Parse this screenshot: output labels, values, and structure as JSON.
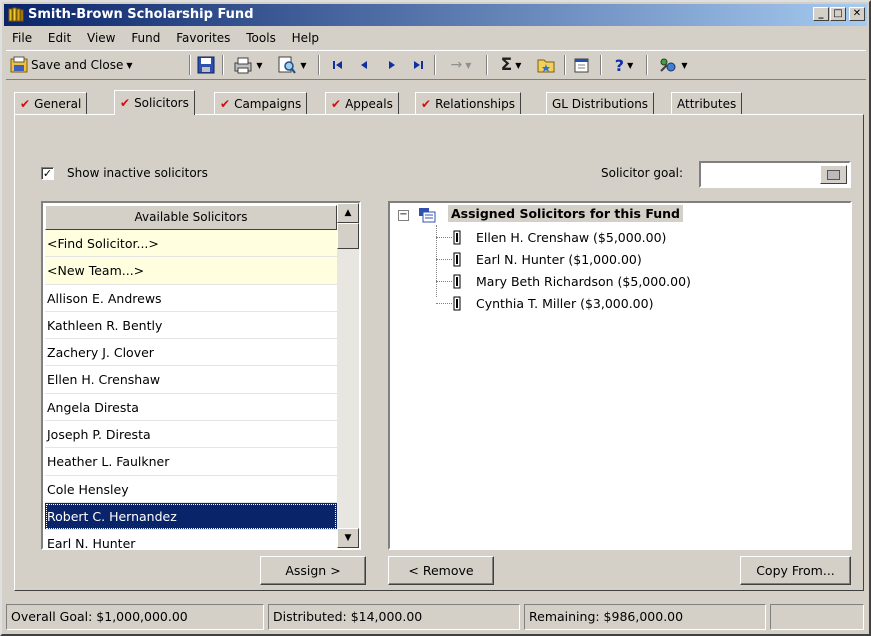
{
  "window": {
    "title": "Smith-Brown Scholarship Fund"
  },
  "menu": [
    "File",
    "Edit",
    "View",
    "Fund",
    "Favorites",
    "Tools",
    "Help"
  ],
  "toolbar": {
    "save_close_label": "Save and Close",
    "icons": [
      "save-close-icon",
      "save-icon",
      "print-icon",
      "preview-icon",
      "first-record-icon",
      "previous-record-icon",
      "next-record-icon",
      "last-record-icon",
      "go-to-icon",
      "sum-icon",
      "folder-icon",
      "properties-icon",
      "help-icon",
      "tools-icon"
    ]
  },
  "tabs": [
    {
      "label": "General",
      "checked": true
    },
    {
      "label": "Solicitors",
      "checked": true,
      "active": true
    },
    {
      "label": "Campaigns",
      "checked": true
    },
    {
      "label": "Appeals",
      "checked": true
    },
    {
      "label": "Relationships",
      "checked": true
    },
    {
      "label": "GL Distributions",
      "checked": false
    },
    {
      "label": "Attributes",
      "checked": false
    }
  ],
  "solicitors": {
    "show_inactive_label": "Show inactive solicitors",
    "show_inactive_checked": true,
    "goal_label": "Solicitor goal:",
    "goal_value": "",
    "available_header": "Available Solicitors",
    "available": [
      "<Find Solicitor...>",
      "<New Team...>",
      "Allison E. Andrews",
      "Kathleen R. Bently",
      "Zachery J. Clover",
      "Ellen H. Crenshaw",
      "Angela Diresta",
      "Joseph P. Diresta",
      "Heather L. Faulkner",
      "Cole Hensley",
      "Robert C. Hernandez",
      "Earl N. Hunter"
    ],
    "selected_index": 10,
    "assigned_root": "Assigned Solicitors for this Fund",
    "assigned": [
      "Ellen H. Crenshaw ($5,000.00)",
      "Earl N. Hunter ($1,000.00)",
      "Mary Beth Richardson ($5,000.00)",
      "Cynthia T. Miller ($3,000.00)"
    ],
    "assign_label": "Assign >",
    "remove_label": "< Remove",
    "copy_from_label": "Copy From..."
  },
  "status": {
    "overall_goal": "Overall Goal: $1,000,000.00",
    "distributed": "Distributed: $14,000.00",
    "remaining": "Remaining: $986,000.00",
    "extra": ""
  },
  "colors": {
    "title_start": "#0a246a",
    "title_end": "#a6caf0",
    "check_red": "#d01010",
    "selection": "#0a246a"
  }
}
